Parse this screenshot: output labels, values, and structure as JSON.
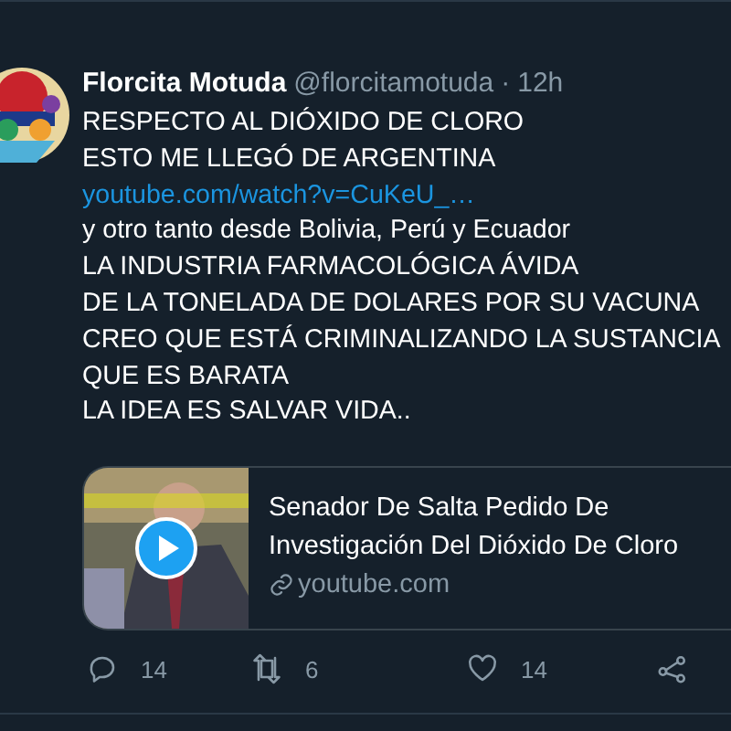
{
  "tweet": {
    "author": {
      "name": "Florcita Motuda",
      "handle": "@florcitamotuda",
      "separator": "·",
      "time": "12h"
    },
    "lines": [
      {
        "kind": "text",
        "text": "RESPECTO AL DIÓXIDO DE CLORO"
      },
      {
        "kind": "text",
        "text": "ESTO ME LLEGÓ DE ARGENTINA"
      },
      {
        "kind": "link",
        "text": "youtube.com/watch?v=CuKeU_…"
      },
      {
        "kind": "text",
        "text": "y otro tanto desde Bolivia, Perú y Ecuador"
      },
      {
        "kind": "text",
        "text": "LA INDUSTRIA FARMACOLÓGICA ÁVIDA"
      },
      {
        "kind": "text",
        "text": "DE LA TONELADA DE DOLARES POR SU VACUNA"
      },
      {
        "kind": "text",
        "text": "CREO QUE ESTÁ CRIMINALIZANDO LA SUSTANCIA"
      },
      {
        "kind": "text",
        "text": "QUE ES BARATA"
      },
      {
        "kind": "text",
        "text": "LA IDEA ES SALVAR VIDA.."
      }
    ],
    "card": {
      "title": "Senador De Salta Pedido De Investigación Del Dióxido De Cloro",
      "domain": "youtube.com"
    },
    "actions": [
      {
        "kind": "reply",
        "count": "14"
      },
      {
        "kind": "retweet",
        "count": "6"
      },
      {
        "kind": "like",
        "count": "14"
      },
      {
        "kind": "share"
      }
    ]
  }
}
